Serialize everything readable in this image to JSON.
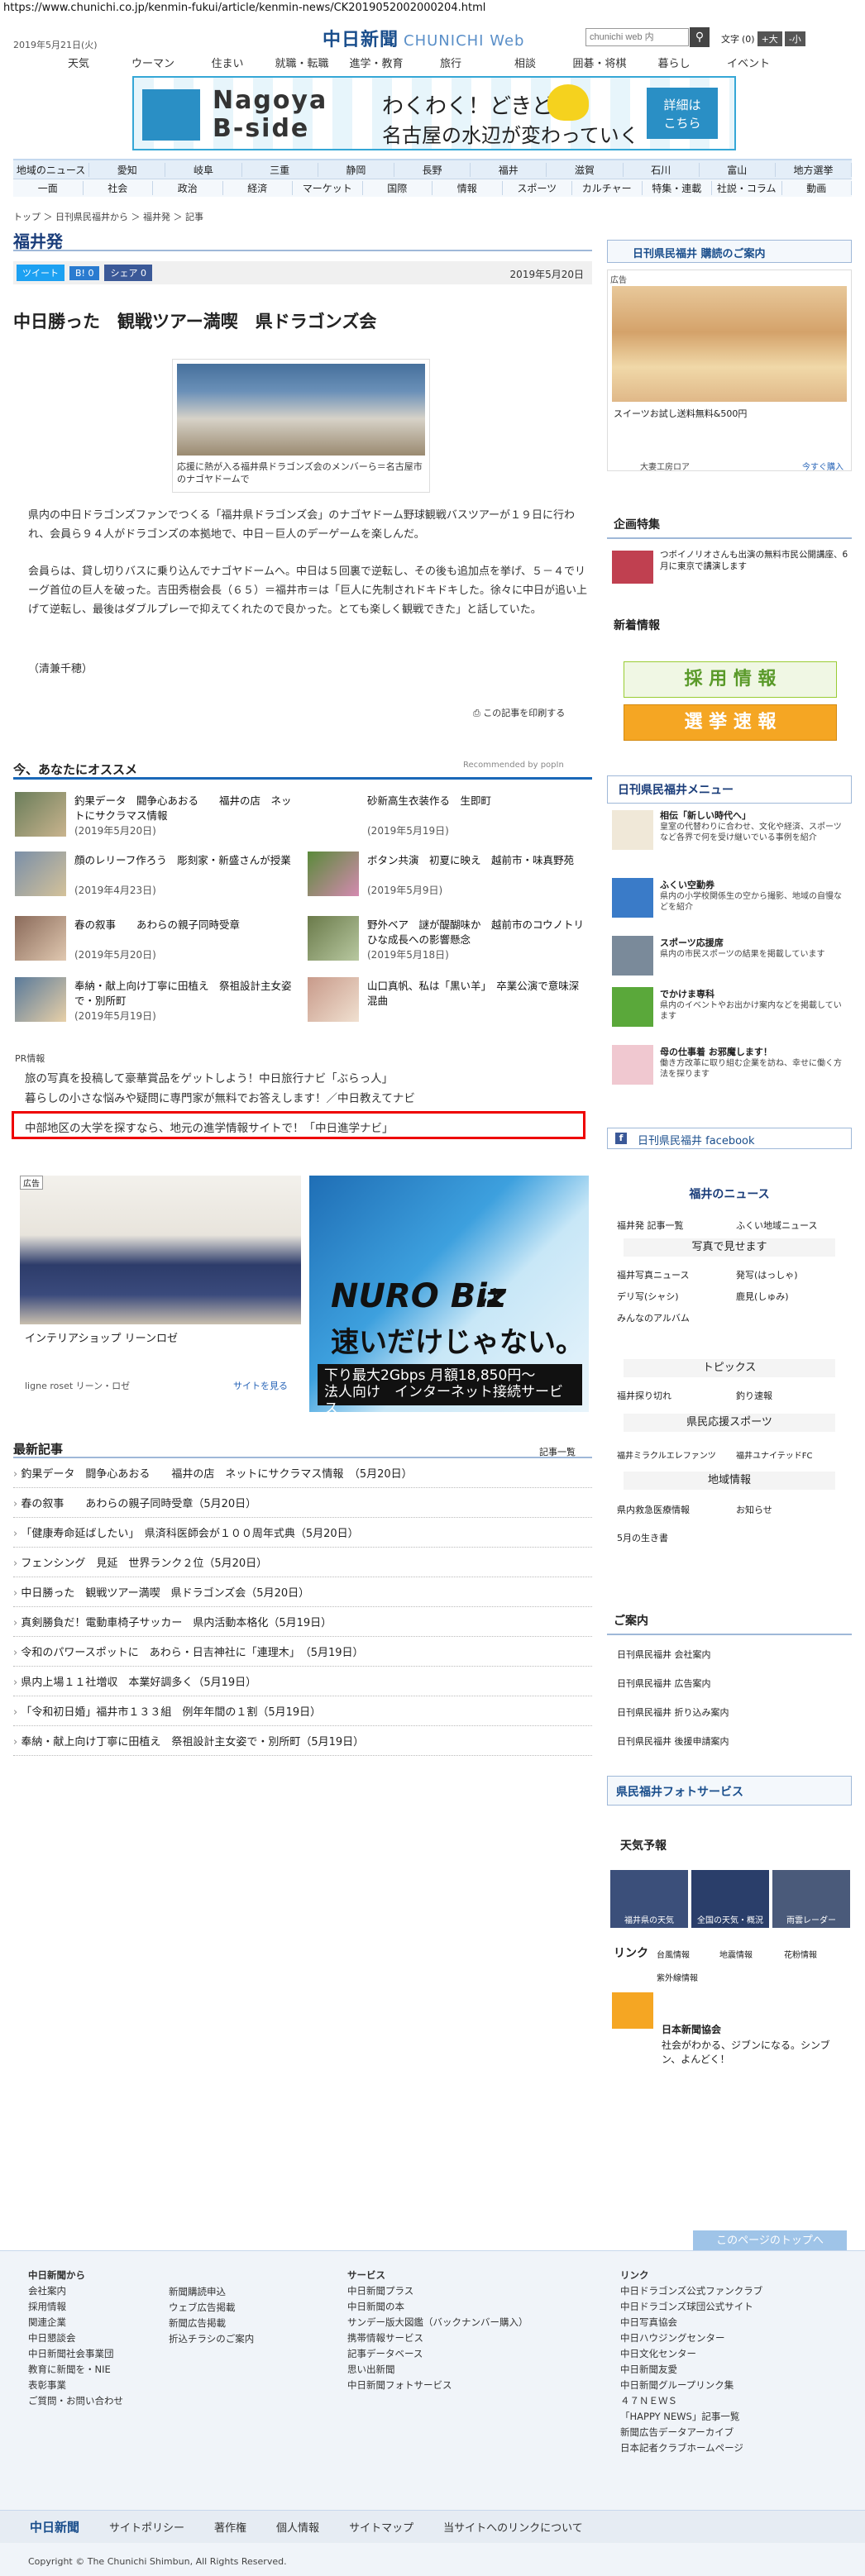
{
  "url": "https://www.chunichi.co.jp/kenmin-fukui/article/kenmin-news/CK2019052002000204.html",
  "header": {
    "date": "2019年5月21日(火)",
    "logo": "中日新聞",
    "logo_sub": "CHUNICHI Web",
    "search_placeholder": "chunichi web 内",
    "font_label": "文字",
    "font_reset": "(0)",
    "font_up": "+大",
    "font_down": "-小"
  },
  "top_nav": [
    "天気",
    "ウーマン",
    "住まい",
    "就職・転職",
    "進学・教育",
    "旅行",
    "相談",
    "囲碁・将棋",
    "暮らし",
    "イベント"
  ],
  "banner": {
    "t1": "Nagoya",
    "t2": "B-side",
    "c1": "わくわく！どきどき！",
    "c2": "名古屋の水辺が変わっていく",
    "btn1": "詳細は",
    "btn2": "こちら"
  },
  "nav_row1": [
    "地域のニュース",
    "愛知",
    "岐阜",
    "三重",
    "静岡",
    "長野",
    "福井",
    "滋賀",
    "石川",
    "富山",
    "地方選挙"
  ],
  "nav_row2": [
    "一面",
    "社会",
    "政治",
    "経済",
    "マーケット",
    "国際",
    "情報",
    "スポーツ",
    "カルチャー",
    "特集・連載",
    "社説・コラム",
    "動画"
  ],
  "breadcrumb": "トップ ＞ 日刊県民福井から ＞ 福井発 ＞ 記事",
  "section_title": "福井発",
  "social": {
    "tweet": "ツイート",
    "b": "B! 0",
    "fb": "シェア 0"
  },
  "article": {
    "date": "2019年5月20日",
    "headline": "中日勝った　観戦ツアー満喫　県ドラゴンズ会",
    "caption": "応援に熱が入る福井県ドラゴンズ会のメンバーら＝名古屋市のナゴヤドームで",
    "p1": "県内の中日ドラゴンズファンでつくる「福井県ドラゴンズ会」のナゴヤドーム野球観戦バスツアーが１９日に行われ、会員ら９４人がドラゴンズの本拠地で、中日－巨人のデーゲームを楽しんだ。",
    "p2": "会員らは、貸し切りバスに乗り込んでナゴヤドームへ。中日は５回裏で逆転し、その後も追加点を挙げ、５－４でリーグ首位の巨人を破った。吉田秀樹会長（６５）＝福井市＝は「巨人に先制されドキドキした。徐々に中日が追い上げて逆転し、最後はダブルプレーで抑えてくれたので良かった。とても楽しく観戦できた」と話していた。",
    "p3": "（清兼千穂）",
    "print": "この記事を印刷する"
  },
  "recommend": {
    "title": "今、あなたにオススメ",
    "by": "Recommended by popIn",
    "items": [
      {
        "title": "釣果データ　闘争心あおる　　福井の店　ネットにサクラマス情報",
        "date": "(2019年5月20日)"
      },
      {
        "title": "砂新高生衣装作る　生即町",
        "date": "(2019年5月19日)"
      },
      {
        "title": "顔のレリーフ作ろう　彫刻家・新盛さんが授業",
        "date": "(2019年4月23日)"
      },
      {
        "title": "ボタン共演　初夏に映え　越前市・味真野苑",
        "date": "(2019年5月9日)"
      },
      {
        "title": "春の叙事　　あわらの親子同時受章",
        "date": "(2019年5月20日)"
      },
      {
        "title": "野外ベア　謎が醍醐味か　越前市のコウノトリひな成長への影響懸念",
        "date": "(2019年5月18日)"
      },
      {
        "title": "奉納・献上向け丁寧に田植え　祭祖設計主女姿で・別所町",
        "date": "(2019年5月19日)"
      },
      {
        "title": "山口真帆、私は「黒い羊」　卒業公演で意味深混曲",
        "date": ""
      }
    ]
  },
  "pr": {
    "label": "PR情報",
    "items": [
      "旅の写真を投稿して豪華賞品をゲットしよう！中日旅行ナビ「ぶらっ人」",
      "暮らしの小さな悩みや疑問に専門家が無料でお答えします！／中日教えてナビ",
      "中部地区の大学を探すなら、地元の進学情報サイトで！「中日進学ナビ」"
    ]
  },
  "ads": {
    "label": "広告",
    "ad1_caption": "インテリアショップ リーンロゼ",
    "ad1_brand": "ligne roset リーン・ロゼ",
    "ad1_link": "サイトを見る",
    "ad2_logo": "NURO Biz",
    "ad2_tx1": "は",
    "ad2_tx2": "速いだけじゃない。",
    "ad2_strip1": "下り最大2Gbps 月額18,850円～",
    "ad2_strip2": "法人向け　インターネット接続サービス"
  },
  "latest": {
    "title": "最新記事",
    "more": "記事一覧",
    "items": [
      "釣果データ　闘争心あおる　　福井の店　ネットにサクラマス情報　（5月20日）",
      "春の叙事　　あわらの親子同時受章（5月20日）",
      "「健康寿命延ばしたい」　県済科医師会が１００周年式典（5月20日）",
      "フェンシング　見延　世界ランク２位（5月20日）",
      "中日勝った　観戦ツアー満喫　県ドラゴンズ会（5月20日）",
      "真剣勝負だ！電動車椅子サッカー　県内活動本格化（5月19日）",
      "令和のパワースポットに　あわら・日吉神社に「連理木」　（5月19日）",
      "県内上場１１社増収　本業好調多く（5月19日）",
      "「令和初日婚」福井市１３３組　例年年間の１割（5月19日）",
      "奉納・献上向け丁寧に田植え　祭祖設計主女姿で・別所町（5月19日）"
    ]
  },
  "side": {
    "subscribe": "日刊県民福井 購読のご案内",
    "ad_label": "広告",
    "ad_text1": "スイーツお試し送料無料&500円",
    "ad_brand": "大妻工房ロア",
    "ad_more": "今すぐ購入",
    "kikaku_title": "企画特集",
    "kikaku_text": "つボイノリオさんも出演の無料市民公開講座、6月に東京で講演します",
    "shinchaku_title": "新着情報",
    "saiyo": "採 用 情 報",
    "senkyo": "選 挙 速 報",
    "menu_title": "日刊県民福井メニュー",
    "menu": [
      {
        "t": "相伝「新しい時代へ」",
        "d": "皇室の代替わりに合わせ、文化や経済、スポーツなど各界で何を受け継いでいる事例を紹介"
      },
      {
        "t": "ふくい空勤券",
        "d": "県内の小学校関係生の空から撮影、地域の自慢などを紹介"
      },
      {
        "t": "スポーツ応援席",
        "d": "県内の市民スポーツの結果を掲載しています"
      },
      {
        "t": "でかけま専科",
        "d": "県内のイベントやお出かけ案内などを掲載しています"
      },
      {
        "t": "母の仕事着 お邪魔します！",
        "d": "働き方改革に取り組む企業を訪ね、幸せに働く方法を探ります"
      }
    ],
    "facebook": "日刊県民福井 facebook",
    "fukui_news": "福井のニュース",
    "news_links": [
      "福井発 記事一覧",
      "ふくい地域ニュース"
    ],
    "photo_title": "写真で見せます",
    "photo_links": [
      "福井写真ニュース",
      "発写(はっしゃ)",
      "デリ写(シャシ)",
      "鹿見(しゅみ)",
      "みんなのアルバム"
    ],
    "topics": "トピックス",
    "topics_links": [
      "福井探り切れ",
      "釣り速報"
    ],
    "sports": "県民応援スポーツ",
    "sports_links": [
      "福井ミラクルエレファンツ",
      "福井ユナイテッドFC"
    ],
    "chiiki": "地域情報",
    "chiiki_links": [
      "県内救急医療情報",
      "お知らせ",
      "5月の生き書"
    ],
    "annai": "ご案内",
    "annai_links": [
      "日刊県民福井 会社案内",
      "日刊県民福井 広告案内",
      "日刊県民福井 折り込み案内",
      "日刊県民福井 後援申請案内"
    ],
    "photo_service": "県民福井フォトサービス",
    "weather_title": "天気予報",
    "weather": [
      "福井県の天気",
      "全国の天気・概況",
      "雨雲レーダー"
    ],
    "link_title": "リンク",
    "link_items": [
      "台風情報",
      "地震情報",
      "花粉情報",
      "紫外線情報"
    ],
    "jnk": "日本新聞協会",
    "jnk_text": "社会がわかる、ジブンになる。シンブン、よんどく！"
  },
  "footer": {
    "totop": "このページのトップへ",
    "col1_title": "中日新聞から",
    "col1": [
      "会社案内",
      "採用情報",
      "関連企業",
      "中日懇談会",
      "中日新聞社会事業団",
      "教育に新聞を・NIE",
      "表彰事業",
      "ご質問・お問い合わせ"
    ],
    "col2": [
      "新聞購読申込",
      "ウェブ広告掲載",
      "新聞広告掲載",
      "折込チラシのご案内"
    ],
    "col3_title": "サービス",
    "col3": [
      "中日新聞プラス",
      "中日新聞の本",
      "サンデー版大図鑑（バックナンバー購入）",
      "携帯情報サービス",
      "記事データベース",
      "思い出新聞",
      "中日新聞フォトサービス"
    ],
    "col4_title": "リンク",
    "col4": [
      "中日ドラゴンズ公式ファンクラブ",
      "中日ドラゴンズ球団公式サイト",
      "中日写真協会",
      "中日ハウジングセンター",
      "中日文化センター",
      "中日新聞友愛",
      "中日新聞グループリンク集",
      "４７ＮＥＷＳ",
      "「HAPPY NEWS」記事一覧",
      "新聞広告データアーカイブ",
      "日本記者クラブホームページ"
    ],
    "bar": [
      "中日新聞",
      "サイトポリシー",
      "著作権",
      "個人情報",
      "サイトマップ",
      "当サイトへのリンクについて"
    ],
    "copyright": "Copyright © The Chunichi Shimbun, All Rights Reserved."
  }
}
